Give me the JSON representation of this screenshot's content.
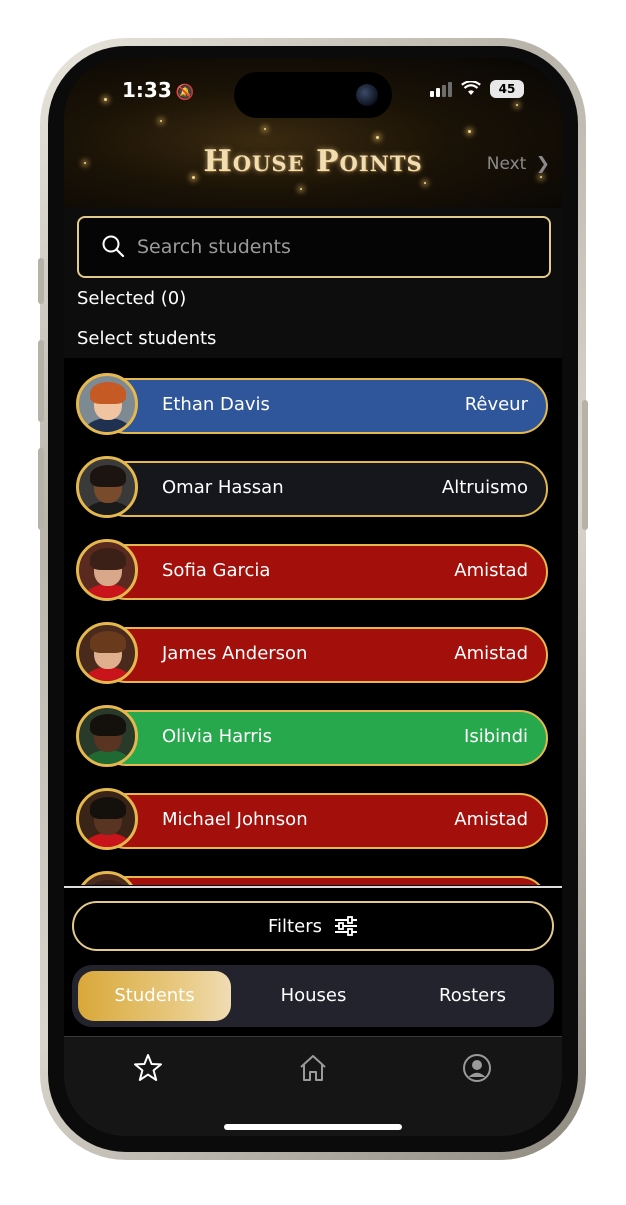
{
  "status_bar": {
    "time": "1:33",
    "battery": "45"
  },
  "header": {
    "title": "House Points",
    "next_label": "Next"
  },
  "search": {
    "placeholder": "Search students",
    "value": ""
  },
  "selected_label": "Selected (0)",
  "select_label": "Select students",
  "students": [
    {
      "name": "Ethan Davis",
      "house": "Rêveur",
      "color": "#2f569a"
    },
    {
      "name": "Omar Hassan",
      "house": "Altruismo",
      "color": "#15171c"
    },
    {
      "name": "Sofia Garcia",
      "house": "Amistad",
      "color": "#a30f0a"
    },
    {
      "name": "James Anderson",
      "house": "Amistad",
      "color": "#a30f0a"
    },
    {
      "name": "Olivia Harris",
      "house": "Isibindi",
      "color": "#27a84c"
    },
    {
      "name": "Michael Johnson",
      "house": "Amistad",
      "color": "#a30f0a"
    },
    {
      "name": "",
      "house": "",
      "color": "#a30f0a"
    }
  ],
  "filters_label": "Filters",
  "segments": [
    {
      "label": "Students",
      "active": true
    },
    {
      "label": "Houses",
      "active": false
    },
    {
      "label": "Rosters",
      "active": false
    }
  ],
  "tabbar": [
    {
      "icon": "star-icon"
    },
    {
      "icon": "home-icon"
    },
    {
      "icon": "profile-icon"
    }
  ],
  "colors": {
    "gold_border": "#e5b84d",
    "active_tab": "#d9a83a"
  }
}
